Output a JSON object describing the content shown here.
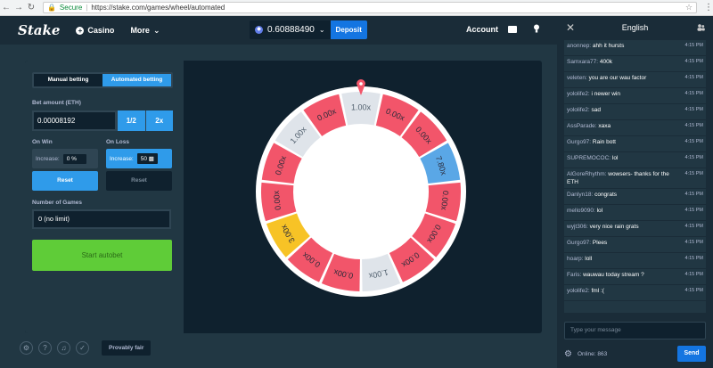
{
  "browser": {
    "secure_label": "Secure",
    "url": "https://stake.com/games/wheel/automated"
  },
  "header": {
    "logo": "Stake",
    "casino": "Casino",
    "more": "More",
    "balance": "0.60888490",
    "deposit": "Deposit",
    "account": "Account"
  },
  "betting": {
    "manual": "Manual betting",
    "automated": "Automated betting",
    "bet_amount_label": "Bet amount (ETH)",
    "bet_amount": "0.00008192",
    "half": "1/2",
    "double": "2x",
    "on_win_label": "On Win",
    "on_loss_label": "On Loss",
    "increase_label": "Increase:",
    "win_increase": "0 %",
    "loss_increase": "50",
    "reset": "Reset",
    "num_games_label": "Number of Games",
    "num_games": "0 (no limit)",
    "start": "Start autobet",
    "provably_fair": "Provably fair"
  },
  "wheel": {
    "segments": [
      {
        "label": "1.00x",
        "color": "#dfe4ea"
      },
      {
        "label": "0.00x",
        "color": "#f2556a"
      },
      {
        "label": "0.00x",
        "color": "#f2556a"
      },
      {
        "label": "7.80x",
        "color": "#5aa7e6"
      },
      {
        "label": "0.00x",
        "color": "#f2556a"
      },
      {
        "label": "0.00x",
        "color": "#f2556a"
      },
      {
        "label": "0.00x",
        "color": "#f2556a"
      },
      {
        "label": "1.00x",
        "color": "#dfe4ea"
      },
      {
        "label": "0.00x",
        "color": "#f2556a"
      },
      {
        "label": "0.00x",
        "color": "#f2556a"
      },
      {
        "label": "3.00x",
        "color": "#f7c326"
      },
      {
        "label": "0.00x",
        "color": "#f2556a"
      },
      {
        "label": "0.00x",
        "color": "#f2556a"
      },
      {
        "label": "1.00x",
        "color": "#dfe4ea"
      },
      {
        "label": "0.00x",
        "color": "#f2556a"
      }
    ],
    "pointer_color": "#f2556a"
  },
  "chat": {
    "title": "English",
    "messages": [
      {
        "user": "anonnep:",
        "text": "ahh it hursts",
        "time": "4:15 PM"
      },
      {
        "user": "Samxara77:",
        "text": "400k",
        "time": "4:15 PM"
      },
      {
        "user": "veleten:",
        "text": "you are our wau factor",
        "time": "4:15 PM"
      },
      {
        "user": "yololife2:",
        "text": "i newer win",
        "time": "4:15 PM"
      },
      {
        "user": "yololife2:",
        "text": "sad",
        "time": "4:15 PM"
      },
      {
        "user": "AssParade:",
        "text": "xaxa",
        "time": "4:15 PM"
      },
      {
        "user": "Gurgo97:",
        "text": "Rain bott",
        "time": "4:15 PM"
      },
      {
        "user": "SUPREMOCOC:",
        "text": "lol",
        "time": "4:15 PM"
      },
      {
        "user": "AlGoreRhythm:",
        "text": "wowsers- thanks for the ETH",
        "time": "4:15 PM"
      },
      {
        "user": "Danlyn18:",
        "text": "congrats",
        "time": "4:15 PM"
      },
      {
        "user": "mello9090:",
        "text": "lol",
        "time": "4:15 PM"
      },
      {
        "user": "wyjt306:",
        "text": "very nice rain grats",
        "time": "4:15 PM"
      },
      {
        "user": "Gurgo97:",
        "text": "Plees",
        "time": "4:15 PM"
      },
      {
        "user": "hoarp:",
        "text": "loll",
        "time": "4:15 PM"
      },
      {
        "user": "Faris:",
        "text": "wauwau today stream ?",
        "time": "4:15 PM"
      },
      {
        "user": "yololife2:",
        "text": "fml :(",
        "time": "4:15 PM"
      }
    ],
    "input_placeholder": "Type your message",
    "online": "Online: 863",
    "send": "Send"
  }
}
